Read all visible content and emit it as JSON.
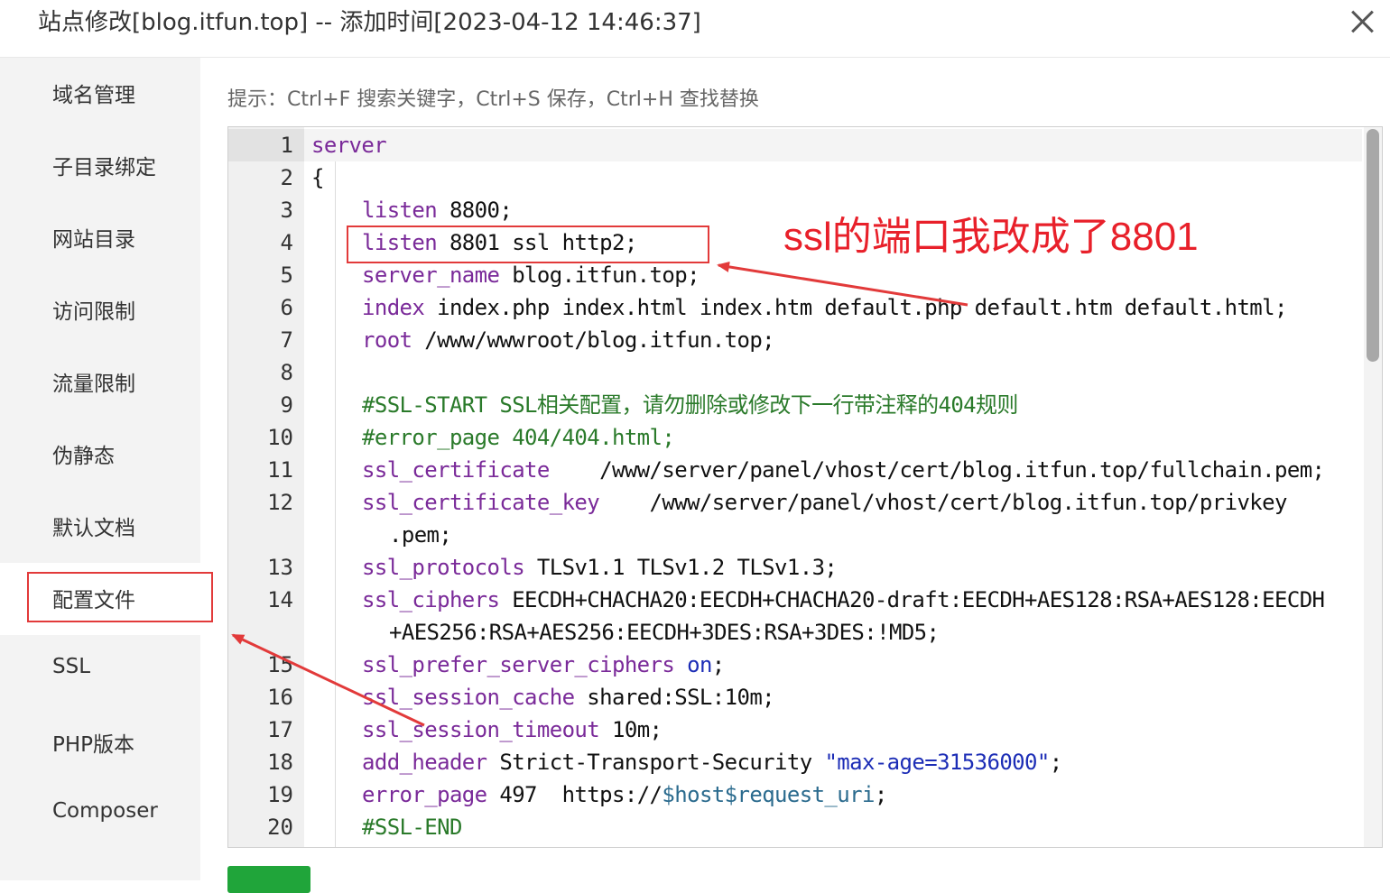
{
  "window": {
    "title": "站点修改[blog.itfun.top] -- 添加时间[2023-04-12 14:46:37]",
    "close_icon": "close-icon"
  },
  "sidebar": {
    "items": [
      {
        "label": "域名管理"
      },
      {
        "label": "子目录绑定"
      },
      {
        "label": "网站目录"
      },
      {
        "label": "访问限制"
      },
      {
        "label": "流量限制"
      },
      {
        "label": "伪静态"
      },
      {
        "label": "默认文档"
      },
      {
        "label": "配置文件",
        "active": true
      },
      {
        "label": "SSL"
      },
      {
        "label": "PHP版本"
      },
      {
        "label": "Composer"
      }
    ]
  },
  "hint": "提示：Ctrl+F 搜索关键字，Ctrl+S 保存，Ctrl+H 查找替换",
  "editor": {
    "line_numbers": [
      "1",
      "2",
      "3",
      "4",
      "5",
      "6",
      "7",
      "8",
      "9",
      "10",
      "11",
      "12",
      "13",
      "14",
      "15",
      "16",
      "17",
      "18",
      "19",
      "20"
    ],
    "lines": [
      "server",
      "{",
      "listen 8800;",
      "listen 8801 ssl http2;",
      "server_name blog.itfun.top;",
      "index index.php index.html index.htm default.php default.htm default.html;",
      "root /www/wwwroot/blog.itfun.top;",
      "",
      "#SSL-START SSL相关配置，请勿删除或修改下一行带注释的404规则",
      "#error_page 404/404.html;",
      "ssl_certificate    /www/server/panel/vhost/cert/blog.itfun.top/fullchain.pem;",
      "ssl_certificate_key    /www/server/panel/vhost/cert/blog.itfun.top/privkey",
      ".pem;",
      "ssl_protocols TLSv1.1 TLSv1.2 TLSv1.3;",
      "ssl_ciphers EECDH+CHACHA20:EECDH+CHACHA20-draft:EECDH+AES128:RSA+AES128:EECDH",
      "+AES256:RSA+AES256:EECDH+3DES:RSA+3DES:!MD5;",
      "ssl_prefer_server_ciphers on;",
      "ssl_session_cache shared:SSL:10m;",
      "ssl_session_timeout 10m;",
      "add_header Strict-Transport-Security \"max-age=31536000\";",
      "error_page 497  https://$host$request_uri;",
      "#SSL-END"
    ]
  },
  "annotation": {
    "text": "ssl的端口我改成了8801",
    "color": "#e8202a"
  },
  "colors": {
    "accent_green": "#20a53a",
    "highlight_red": "#e23a3a"
  }
}
